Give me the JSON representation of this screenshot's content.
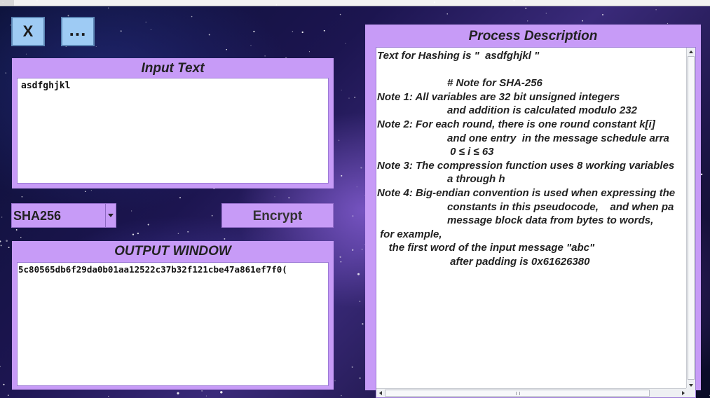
{
  "window": {
    "close_label": "X",
    "more_label": "..."
  },
  "input": {
    "title": "Input Text",
    "value": "asdfghjkl"
  },
  "controls": {
    "algorithm_selected": "SHA256",
    "encrypt_label": "Encrypt"
  },
  "output": {
    "title": "OUTPUT WINDOW",
    "value": "5c80565db6f29da0b01aa12522c37b32f121cbe47a861ef7f0("
  },
  "process": {
    "title": "Process Description",
    "lines": [
      "Text for Hashing is \"  asdfghjkl \"",
      "",
      "                        # Note for SHA-256",
      "Note 1: All variables are 32 bit unsigned integers",
      "                        and addition is calculated modulo 232",
      "Note 2: For each round, there is one round constant k[i]",
      "                        and one entry  in the message schedule arra",
      "                         0 ≤ i ≤ 63",
      "Note 3: The compression function uses 8 working variables",
      "                        a through h",
      "Note 4: Big-endian convention is used when expressing the",
      "                        constants in this pseudocode,    and when pa",
      "                        message block data from bytes to words,",
      " for example,",
      "    the first word of the input message \"abc\"",
      "                         after padding is 0x61626380"
    ]
  },
  "colors": {
    "panel": "#c79bf7",
    "window_button": "#9ecbf4"
  }
}
